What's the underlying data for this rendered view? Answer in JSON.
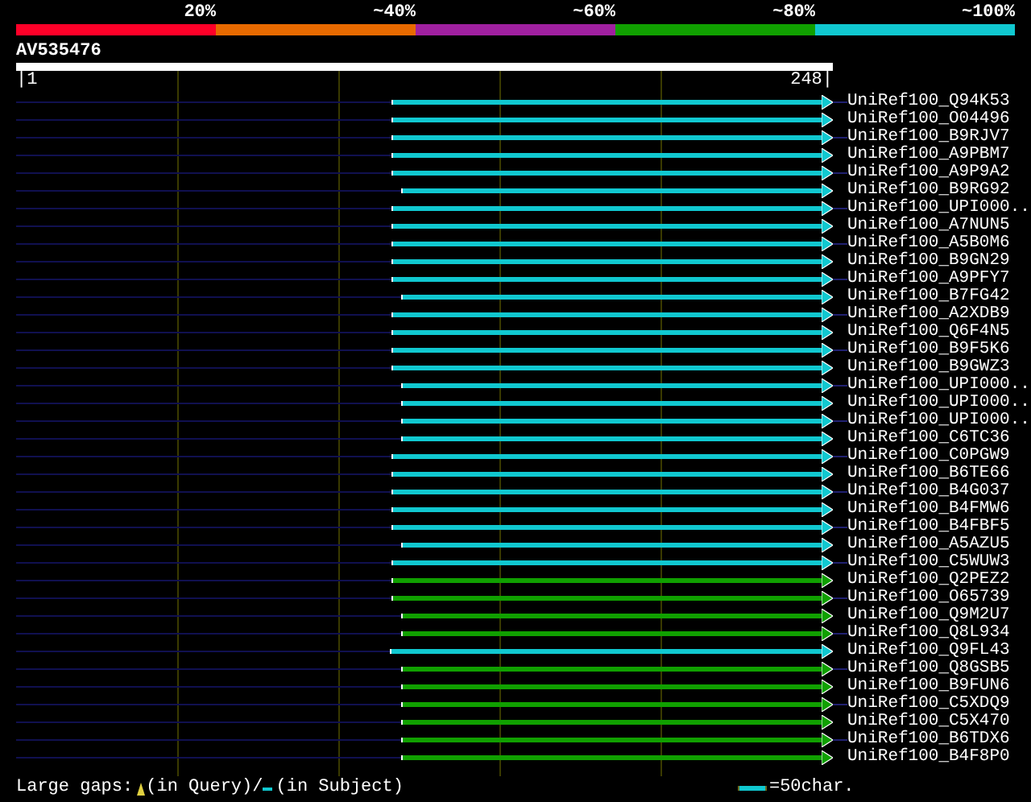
{
  "percent_scale": [
    {
      "label": "20%",
      "color": "#ff0028"
    },
    {
      "label": "~40%",
      "color": "#e86a00"
    },
    {
      "label": "~60%",
      "color": "#a020a0"
    },
    {
      "label": "~80%",
      "color": "#10a000"
    },
    {
      "label": "~100%",
      "color": "#10c8d0"
    }
  ],
  "query": {
    "name": "AV535476",
    "start": "|1",
    "end": "248|"
  },
  "hits": [
    {
      "name": "UniRef100_Q94K53",
      "color": "#10c8d0",
      "level": 0.534,
      "tail": true
    },
    {
      "name": "UniRef100_O04496",
      "color": "#10c8d0",
      "level": 0.534,
      "tail": false
    },
    {
      "name": "UniRef100_B9RJV7",
      "color": "#10c8d0",
      "level": 0.534,
      "tail": true
    },
    {
      "name": "UniRef100_A9PBM7",
      "color": "#10c8d0",
      "level": 0.534,
      "tail": false
    },
    {
      "name": "UniRef100_A9P9A2",
      "color": "#10c8d0",
      "level": 0.534,
      "tail": true
    },
    {
      "name": "UniRef100_B9RG92",
      "color": "#10c8d0",
      "level": 0.522,
      "tail": false
    },
    {
      "name": "UniRef100_UPI000..",
      "color": "#10c8d0",
      "level": 0.534,
      "tail": true
    },
    {
      "name": "UniRef100_A7NUN5",
      "color": "#10c8d0",
      "level": 0.534,
      "tail": false
    },
    {
      "name": "UniRef100_A5B0M6",
      "color": "#10c8d0",
      "level": 0.534,
      "tail": true
    },
    {
      "name": "UniRef100_B9GN29",
      "color": "#10c8d0",
      "level": 0.534,
      "tail": false
    },
    {
      "name": "UniRef100_A9PFY7",
      "color": "#10c8d0",
      "level": 0.534,
      "tail": true
    },
    {
      "name": "UniRef100_B7FG42",
      "color": "#10c8d0",
      "level": 0.522,
      "tail": false
    },
    {
      "name": "UniRef100_A2XDB9",
      "color": "#10c8d0",
      "level": 0.534,
      "tail": true
    },
    {
      "name": "UniRef100_Q6F4N5",
      "color": "#10c8d0",
      "level": 0.534,
      "tail": false
    },
    {
      "name": "UniRef100_B9F5K6",
      "color": "#10c8d0",
      "level": 0.534,
      "tail": true
    },
    {
      "name": "UniRef100_B9GWZ3",
      "color": "#10c8d0",
      "level": 0.534,
      "tail": false
    },
    {
      "name": "UniRef100_UPI000..",
      "color": "#10c8d0",
      "level": 0.522,
      "tail": true
    },
    {
      "name": "UniRef100_UPI000..",
      "color": "#10c8d0",
      "level": 0.522,
      "tail": false
    },
    {
      "name": "UniRef100_UPI000..",
      "color": "#10c8d0",
      "level": 0.522,
      "tail": true
    },
    {
      "name": "UniRef100_C6TC36",
      "color": "#10c8d0",
      "level": 0.522,
      "tail": false
    },
    {
      "name": "UniRef100_C0PGW9",
      "color": "#10c8d0",
      "level": 0.534,
      "tail": true
    },
    {
      "name": "UniRef100_B6TE66",
      "color": "#10c8d0",
      "level": 0.534,
      "tail": false
    },
    {
      "name": "UniRef100_B4G037",
      "color": "#10c8d0",
      "level": 0.534,
      "tail": true
    },
    {
      "name": "UniRef100_B4FMW6",
      "color": "#10c8d0",
      "level": 0.534,
      "tail": false
    },
    {
      "name": "UniRef100_B4FBF5",
      "color": "#10c8d0",
      "level": 0.534,
      "tail": true
    },
    {
      "name": "UniRef100_A5AZU5",
      "color": "#10c8d0",
      "level": 0.522,
      "tail": false
    },
    {
      "name": "UniRef100_C5WUW3",
      "color": "#10c8d0",
      "level": 0.534,
      "tail": true
    },
    {
      "name": "UniRef100_Q2PEZ2",
      "color": "#10a000",
      "level": 0.534,
      "tail": false
    },
    {
      "name": "UniRef100_O65739",
      "color": "#10a000",
      "level": 0.534,
      "tail": true
    },
    {
      "name": "UniRef100_Q9M2U7",
      "color": "#10a000",
      "level": 0.522,
      "tail": false
    },
    {
      "name": "UniRef100_Q8L934",
      "color": "#10a000",
      "level": 0.522,
      "tail": true
    },
    {
      "name": "UniRef100_Q9FL43",
      "color": "#10c8d0",
      "level": 0.536,
      "tail": false
    },
    {
      "name": "UniRef100_Q8GSB5",
      "color": "#10a000",
      "level": 0.522,
      "tail": true
    },
    {
      "name": "UniRef100_B9FUN6",
      "color": "#10a000",
      "level": 0.522,
      "tail": false
    },
    {
      "name": "UniRef100_C5XDQ9",
      "color": "#10a000",
      "level": 0.522,
      "tail": true
    },
    {
      "name": "UniRef100_C5X470",
      "color": "#10a000",
      "level": 0.522,
      "tail": false
    },
    {
      "name": "UniRef100_B6TDX6",
      "color": "#10a000",
      "level": 0.522,
      "tail": true
    },
    {
      "name": "UniRef100_B4F8P0",
      "color": "#10a000",
      "level": 0.522,
      "tail": false
    }
  ],
  "footer": {
    "gaps_label": "Large gaps:",
    "query_label": "(in Query)/",
    "subject_label": "(in Subject)",
    "scale_label": "=50char."
  }
}
